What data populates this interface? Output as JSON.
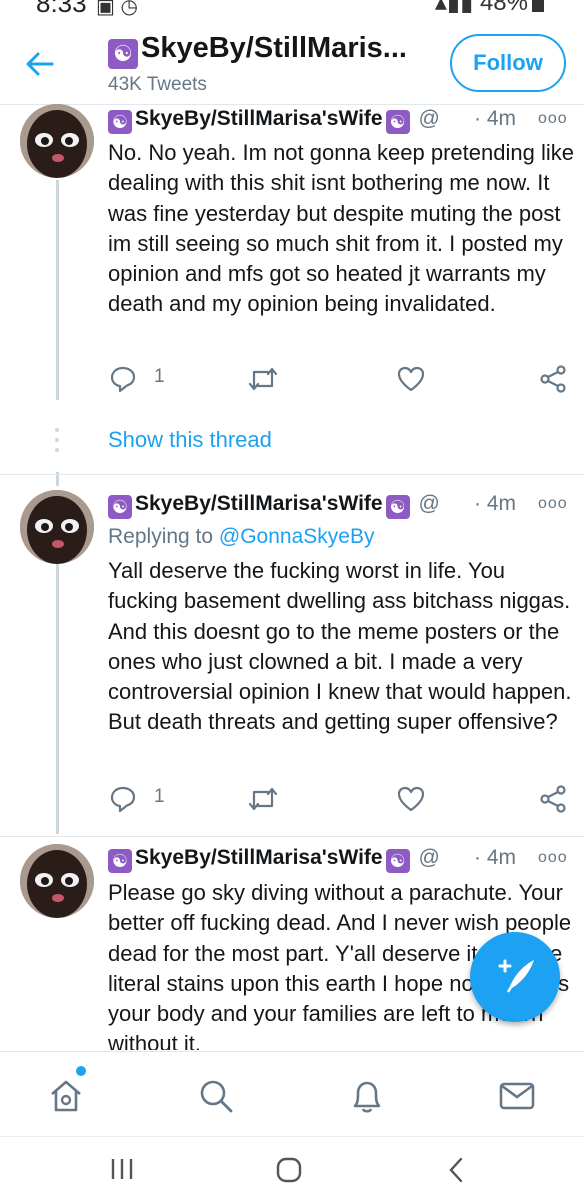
{
  "status_bar": {
    "time": "8:33",
    "battery": "48%"
  },
  "header": {
    "title": "SkyeBy/StillMaris...",
    "tweet_count": "43K Tweets",
    "follow_label": "Follow"
  },
  "tweets": [
    {
      "name": "SkyeBy/StillMarisa'sWife",
      "handle": "@",
      "time": "· 4m",
      "text": "No. No yeah. Im not gonna keep pretending like dealing with this shit isnt bothering me now. It was fine yesterday but despite muting the post im still seeing so much shit from it. I posted my opinion and mfs got so heated jt warrants my death and my opinion being invalidated.",
      "reply_count": "1"
    },
    {
      "name": "SkyeBy/StillMarisa'sWife",
      "handle": "@",
      "time": "· 4m",
      "replying_label": "Replying to",
      "replying_handle": "@GonnaSkyeBy",
      "text": "Yall deserve the fucking worst in life. You fucking basement dwelling ass bitchass niggas. And this doesnt go to the meme posters or the ones who just clowned a bit. I made a very controversial opinion I knew that would happen. But death threats and getting super offensive?",
      "reply_count": "1"
    },
    {
      "name": "SkyeBy/StillMarisa'sWife",
      "handle": "@",
      "time": "· 4m",
      "text": "Please go sky diving without a parachute. Your better off fucking dead. And I never wish people dead for the most part. Y'all deserve it. Yall are literal stains upon this earth I hope no one finds your body and your families are left to mourn without it."
    }
  ],
  "show_thread_label": "Show this thread",
  "emoji_symbol": "☯",
  "icons": {
    "back": "back-arrow-icon",
    "reply": "reply-icon",
    "retweet": "retweet-icon",
    "like": "heart-icon",
    "share": "share-icon",
    "compose": "compose-tweet-icon",
    "home": "home-icon",
    "search": "search-icon",
    "notifications": "bell-icon",
    "messages": "mail-icon"
  },
  "colors": {
    "accent": "#1da1f2",
    "secondary_text": "#657786",
    "divider": "#e1e8ed"
  }
}
